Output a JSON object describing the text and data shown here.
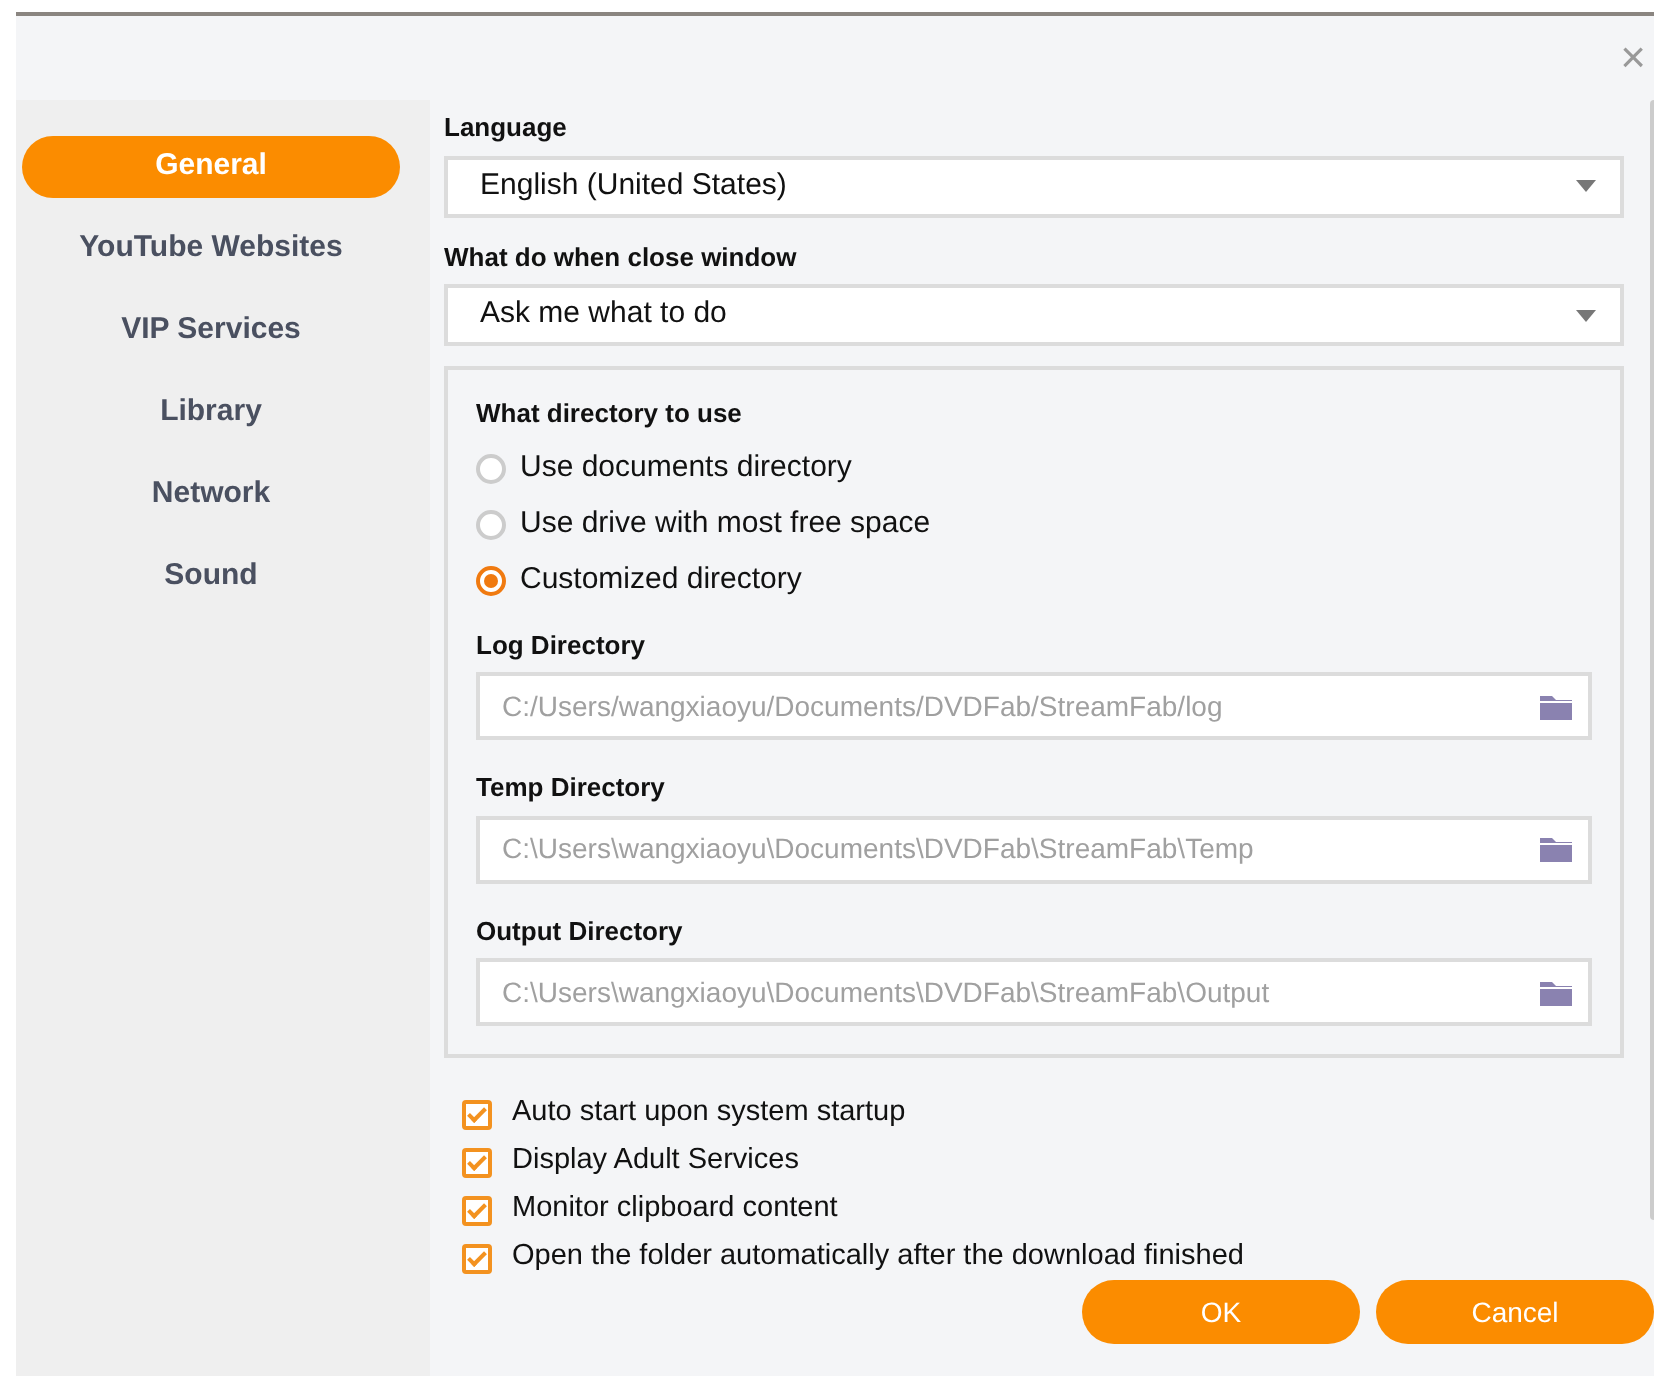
{
  "close_glyph": "×",
  "sidebar": {
    "items": [
      {
        "label": "General",
        "selected": true
      },
      {
        "label": "YouTube Websites",
        "selected": false
      },
      {
        "label": "VIP Services",
        "selected": false
      },
      {
        "label": "Library",
        "selected": false
      },
      {
        "label": "Network",
        "selected": false
      },
      {
        "label": "Sound",
        "selected": false
      }
    ]
  },
  "dropdowns": [
    {
      "label": "Language",
      "value": "English (United States)"
    },
    {
      "label": "What do when close window",
      "value": "Ask me what to do"
    }
  ],
  "directory_panel": {
    "title": "What directory to use",
    "options": [
      {
        "label": "Use documents directory",
        "selected": false
      },
      {
        "label": "Use drive with most free space",
        "selected": false
      },
      {
        "label": "Customized directory",
        "selected": true
      }
    ],
    "paths": [
      {
        "label": "Log Directory",
        "value": "C:/Users/wangxiaoyu/Documents/DVDFab/StreamFab/log"
      },
      {
        "label": "Temp Directory",
        "value": "C:\\Users\\wangxiaoyu\\Documents\\DVDFab\\StreamFab\\Temp"
      },
      {
        "label": "Output Directory",
        "value": "C:\\Users\\wangxiaoyu\\Documents\\DVDFab\\StreamFab\\Output"
      }
    ]
  },
  "checkboxes": [
    {
      "label": "Auto start upon system startup",
      "checked": true
    },
    {
      "label": "Display Adult Services",
      "checked": true
    },
    {
      "label": "Monitor clipboard content",
      "checked": true
    },
    {
      "label": "Open the folder automatically after the download finished",
      "checked": true
    }
  ],
  "buttons": [
    "OK",
    "Cancel"
  ]
}
